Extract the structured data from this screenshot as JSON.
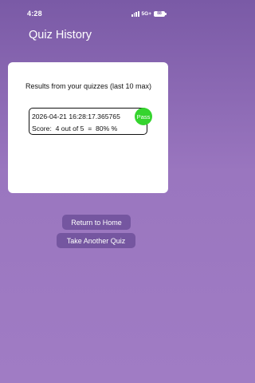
{
  "status_bar": {
    "time": "4:28",
    "network": "5G+",
    "battery": "88"
  },
  "header": {
    "title": "Quiz History"
  },
  "history": {
    "heading": "Results from your quizzes (last 10 max)",
    "entries": [
      {
        "date": "2026-04-21 16:28:17.365765",
        "score": "Score:  4 out of 5  =  80% %",
        "status": "Pass",
        "status_color": "#35d42e"
      }
    ]
  },
  "actions": {
    "home_label": "Return to Home",
    "quiz_label": "Take Another Quiz"
  },
  "colors": {
    "background_top": "#7a5aa6",
    "background_bottom": "#a07cc4",
    "button": "#7556a0"
  }
}
